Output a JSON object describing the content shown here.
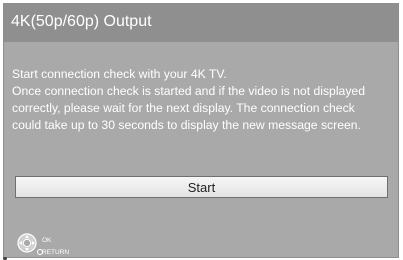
{
  "title": "4K(50p/60p) Output",
  "message_lines": [
    "Start connection check with your 4K TV.",
    "Once connection check is started and if the video is not displayed",
    "correctly, please wait for the next display. The connection check",
    "could take up to 30 seconds to display the new message screen."
  ],
  "start_button_label": "Start",
  "legend": {
    "ok_label": "OK",
    "return_label": "RETURN",
    "pad_icon": "dpad-ok-icon",
    "return_icon": "return-circle-icon"
  },
  "colors": {
    "panel": "#a9a9a9",
    "title_bar": "#8f8f8f",
    "text": "#ffffff",
    "button": "#efefef"
  }
}
